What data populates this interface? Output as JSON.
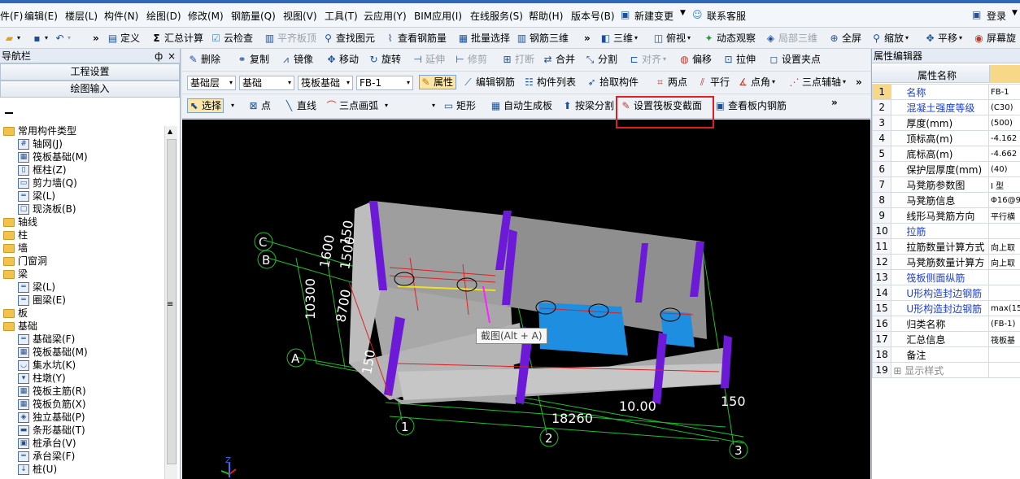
{
  "menu": [
    "件(F)",
    "编辑(E)",
    "楼层(L)",
    "构件(N)",
    "绘图(D)",
    "修改(M)",
    "钢筋量(Q)",
    "视图(V)",
    "工具(T)",
    "云应用(Y)",
    "BIM应用(I)",
    "在线服务(S)",
    "帮助(H)",
    "版本号(B)",
    "新建变更",
    "联系客服",
    "登录"
  ],
  "toolbar1": [
    "定义",
    "汇总计算",
    "云检查",
    "平齐板顶",
    "查找图元",
    "查看钢筋量",
    "批量选择",
    "钢筋三维",
    "三维",
    "俯视",
    "动态观察",
    "局部三维",
    "全屏",
    "缩放",
    "平移",
    "屏幕旋"
  ],
  "left_panel": {
    "title": "导航栏",
    "pin": "ф",
    "close": "×",
    "btn_project": "工程设置",
    "btn_draw": "绘图输入",
    "tree": [
      {
        "type": "folder",
        "label": "常用构件类型",
        "indent": 0
      },
      {
        "type": "item",
        "label": "轴网(J)",
        "indent": 1,
        "glyph": "#"
      },
      {
        "type": "item",
        "label": "筏板基础(M)",
        "indent": 1,
        "glyph": "▦"
      },
      {
        "type": "item",
        "label": "框柱(Z)",
        "indent": 1,
        "glyph": "▯"
      },
      {
        "type": "item",
        "label": "剪力墙(Q)",
        "indent": 1,
        "glyph": "▭"
      },
      {
        "type": "item",
        "label": "梁(L)",
        "indent": 1,
        "glyph": "═"
      },
      {
        "type": "item",
        "label": "现浇板(B)",
        "indent": 1,
        "glyph": "▢"
      },
      {
        "type": "folder",
        "label": "轴线",
        "indent": 0
      },
      {
        "type": "folder",
        "label": "柱",
        "indent": 0
      },
      {
        "type": "folder",
        "label": "墙",
        "indent": 0
      },
      {
        "type": "folder",
        "label": "门窗洞",
        "indent": 0
      },
      {
        "type": "folder",
        "label": "梁",
        "indent": 0
      },
      {
        "type": "item",
        "label": "梁(L)",
        "indent": 1,
        "glyph": "═"
      },
      {
        "type": "item",
        "label": "圈梁(E)",
        "indent": 1,
        "glyph": "═"
      },
      {
        "type": "folder",
        "label": "板",
        "indent": 0
      },
      {
        "type": "folder",
        "label": "基础",
        "indent": 0
      },
      {
        "type": "item",
        "label": "基础梁(F)",
        "indent": 1,
        "glyph": "═"
      },
      {
        "type": "item",
        "label": "筏板基础(M)",
        "indent": 1,
        "glyph": "▦"
      },
      {
        "type": "item",
        "label": "集水坑(K)",
        "indent": 1,
        "glyph": "◡"
      },
      {
        "type": "item",
        "label": "柱墩(Y)",
        "indent": 1,
        "glyph": "▾"
      },
      {
        "type": "item",
        "label": "筏板主筋(R)",
        "indent": 1,
        "glyph": "▦"
      },
      {
        "type": "item",
        "label": "筏板负筋(X)",
        "indent": 1,
        "glyph": "▦"
      },
      {
        "type": "item",
        "label": "独立基础(P)",
        "indent": 1,
        "glyph": "◈"
      },
      {
        "type": "item",
        "label": "条形基础(T)",
        "indent": 1,
        "glyph": "▬"
      },
      {
        "type": "item",
        "label": "桩承台(V)",
        "indent": 1,
        "glyph": "▣"
      },
      {
        "type": "item",
        "label": "承台梁(F)",
        "indent": 1,
        "glyph": "═"
      },
      {
        "type": "item",
        "label": "桩(U)",
        "indent": 1,
        "glyph": "↓"
      }
    ]
  },
  "edit_toolbar": [
    "删除",
    "复制",
    "镜像",
    "移动",
    "旋转",
    "延伸",
    "修剪",
    "打断",
    "合并",
    "分割",
    "对齐",
    "偏移",
    "拉伸",
    "设置夹点"
  ],
  "layer_toolbar": {
    "floor": "基础层",
    "category": "基础",
    "type": "筏板基础",
    "instance": "FB-1",
    "buttons": [
      "属性",
      "编辑钢筋",
      "构件列表",
      "拾取构件",
      "两点",
      "平行",
      "点角",
      "三点辅轴"
    ]
  },
  "draw_toolbar": [
    "选择",
    "点",
    "直线",
    "三点画弧",
    "矩形",
    "自动生成板",
    "按梁分割",
    "设置筏板变截面",
    "查看板内钢筋"
  ],
  "canvas": {
    "tooltip": "截图(Alt + A)",
    "dims": [
      "10300",
      "8700",
      "1600",
      "1500",
      "150",
      "18260",
      "150",
      "150",
      "10.00"
    ],
    "axes": [
      "C",
      "B",
      "A",
      "1",
      "2",
      "3"
    ],
    "axis_label": "Z"
  },
  "right_panel": {
    "title": "属性编辑器",
    "header_name": "属性名称",
    "rows": [
      {
        "n": "1",
        "name": "名称",
        "value": "FB-1",
        "blue": true
      },
      {
        "n": "2",
        "name": "混凝土强度等级",
        "value": "(C30)",
        "blue": true
      },
      {
        "n": "3",
        "name": "厚度(mm)",
        "value": "(500)",
        "blue": false
      },
      {
        "n": "4",
        "name": "顶标高(m)",
        "value": "-4.162",
        "blue": false
      },
      {
        "n": "5",
        "name": "底标高(m)",
        "value": "-4.662",
        "blue": false
      },
      {
        "n": "6",
        "name": "保护层厚度(mm)",
        "value": "(40)",
        "blue": false
      },
      {
        "n": "7",
        "name": "马凳筋参数图",
        "value": "I 型",
        "blue": false
      },
      {
        "n": "8",
        "name": "马凳筋信息",
        "value": "Φ16@9",
        "blue": false
      },
      {
        "n": "9",
        "name": "线形马凳筋方向",
        "value": "平行横",
        "blue": false
      },
      {
        "n": "10",
        "name": "拉筋",
        "value": "",
        "blue": true
      },
      {
        "n": "11",
        "name": "拉筋数量计算方式",
        "value": "向上取",
        "blue": false
      },
      {
        "n": "12",
        "name": "马凳筋数量计算方",
        "value": "向上取",
        "blue": false
      },
      {
        "n": "13",
        "name": "筏板侧面纵筋",
        "value": "",
        "blue": true
      },
      {
        "n": "14",
        "name": "U形构造封边钢筋",
        "value": "",
        "blue": true
      },
      {
        "n": "15",
        "name": "U形构造封边钢筋",
        "value": "max(15",
        "blue": true
      },
      {
        "n": "16",
        "name": "归类名称",
        "value": "(FB-1)",
        "blue": false
      },
      {
        "n": "17",
        "name": "汇总信息",
        "value": "筏板基",
        "blue": false
      },
      {
        "n": "18",
        "name": "备注",
        "value": "",
        "blue": false
      },
      {
        "n": "19",
        "name": "显示样式",
        "value": "",
        "blue": false
      }
    ]
  }
}
